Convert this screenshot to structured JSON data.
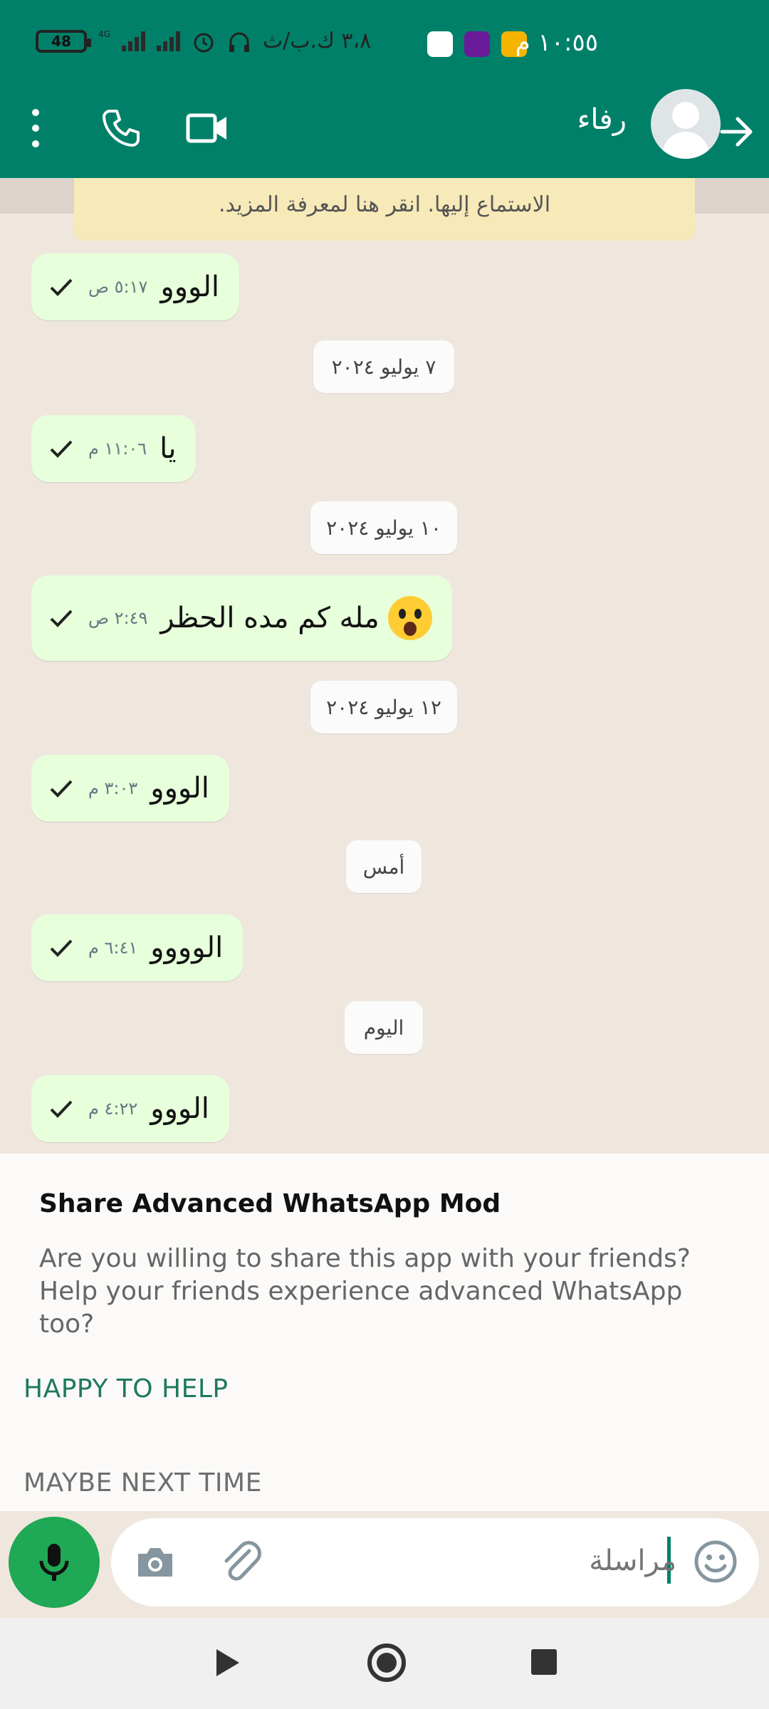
{
  "status_bar": {
    "time": "١٠:٥٥ م",
    "battery": "48",
    "network": "4G",
    "data_speed": "٣،٨ ك.ب/ث"
  },
  "header": {
    "contact_name": "رفاء"
  },
  "notice": {
    "text": "الاستماع إليها. انقر هنا لمعرفة المزيد."
  },
  "messages": [
    {
      "text": "الووو",
      "time": "٥:١٧ ص"
    },
    {
      "text": "يا",
      "time": "١١:٠٦ م"
    },
    {
      "text": "مله كم مده الحظر",
      "time": "٢:٤٩ ص"
    },
    {
      "text": "الووو",
      "time": "٣:٠٣ م"
    },
    {
      "text": "الوووو",
      "time": "٦:٤١ م"
    },
    {
      "text": "الووو",
      "time": "٤:٢٢ م"
    }
  ],
  "dates": [
    "٧ يوليو ٢٠٢٤",
    "١٠ يوليو ٢٠٢٤",
    "١٢ يوليو ٢٠٢٤",
    "أمس",
    "اليوم"
  ],
  "share_sheet": {
    "title": "Share Advanced WhatsApp Mod",
    "body": "Are you willing to share this app with your friends? Help your friends experience advanced WhatsApp too?",
    "primary_action": "HAPPY TO HELP",
    "secondary_action": "MAYBE NEXT TIME"
  },
  "input": {
    "placeholder": "مراسلة"
  },
  "colors": {
    "brand_green": "#008069",
    "bubble_out": "#e7ffdb",
    "mic_green": "#1fa855",
    "action_green": "#1f7a5c"
  },
  "icons": [
    "back-arrow-icon",
    "menu-icon",
    "call-icon",
    "video-icon",
    "mic-icon",
    "camera-icon",
    "attach-icon",
    "emoji-icon",
    "check-icon"
  ]
}
